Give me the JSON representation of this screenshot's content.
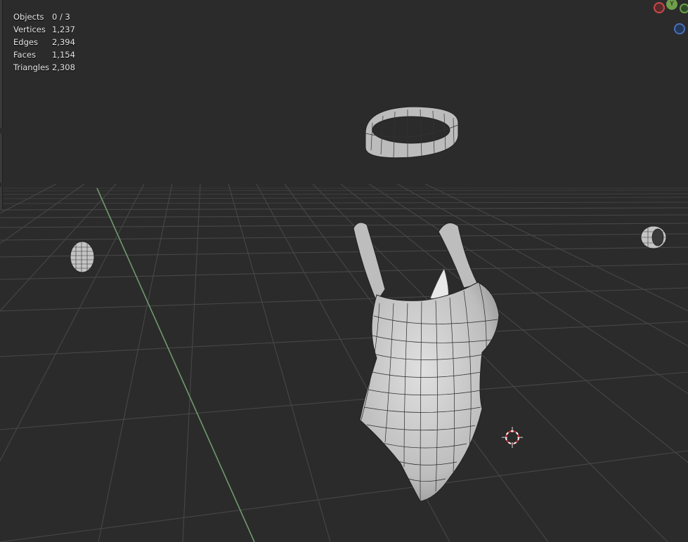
{
  "viewport": {
    "stats": [
      {
        "label": "Objects",
        "value": "0 / 3"
      },
      {
        "label": "Vertices",
        "value": "1,237"
      },
      {
        "label": "Edges",
        "value": "2,394"
      },
      {
        "label": "Faces",
        "value": "1,154"
      },
      {
        "label": "Triangles",
        "value": "2,308"
      }
    ],
    "gizmo": {
      "y_label": "Y"
    },
    "colors": {
      "background": "#2b2b2c",
      "grid": "#4a4a4b",
      "y_axis": "#6f9a6c",
      "mesh": "#c9c9c9",
      "wire": "#1a1a1a",
      "cursor_red": "#d03030",
      "gizmo_x": "#c84b4b",
      "gizmo_y": "#6ea04a",
      "gizmo_z": "#4a70b8"
    }
  }
}
